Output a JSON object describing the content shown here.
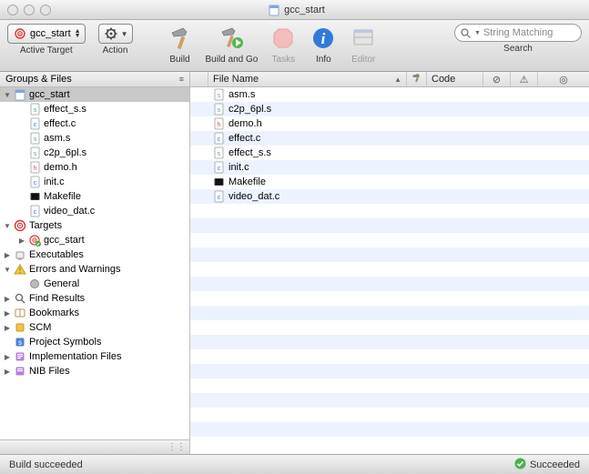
{
  "window": {
    "title": "gcc_start"
  },
  "toolbar": {
    "active_target": {
      "label": "gcc_start",
      "caption": "Active Target"
    },
    "action": {
      "caption": "Action"
    },
    "build": {
      "caption": "Build"
    },
    "build_go": {
      "caption": "Build and Go"
    },
    "tasks": {
      "caption": "Tasks"
    },
    "info": {
      "caption": "Info"
    },
    "editor": {
      "caption": "Editor"
    },
    "search": {
      "placeholder": "String Matching",
      "caption": "Search"
    }
  },
  "sidebar": {
    "header": "Groups & Files",
    "items": [
      {
        "label": "gcc_start",
        "icon": "xcode-project",
        "depth": 0,
        "disclosure": "open",
        "selected": true
      },
      {
        "label": "effect_s.s",
        "icon": "file-s",
        "depth": 1
      },
      {
        "label": "effect.c",
        "icon": "file-c",
        "depth": 1
      },
      {
        "label": "asm.s",
        "icon": "file-s",
        "depth": 1
      },
      {
        "label": "c2p_6pl.s",
        "icon": "file-s",
        "depth": 1
      },
      {
        "label": "demo.h",
        "icon": "file-h",
        "depth": 1
      },
      {
        "label": "init.c",
        "icon": "file-c",
        "depth": 1
      },
      {
        "label": "Makefile",
        "icon": "file-make",
        "depth": 1
      },
      {
        "label": "video_dat.c",
        "icon": "file-c",
        "depth": 1
      },
      {
        "label": "Targets",
        "icon": "target-group",
        "depth": 0,
        "disclosure": "open"
      },
      {
        "label": "gcc_start",
        "icon": "target",
        "depth": 1,
        "disclosure": "closed"
      },
      {
        "label": "Executables",
        "icon": "executables",
        "depth": 0,
        "disclosure": "closed"
      },
      {
        "label": "Errors and Warnings",
        "icon": "warnings",
        "depth": 0,
        "disclosure": "open"
      },
      {
        "label": "General",
        "icon": "general",
        "depth": 1
      },
      {
        "label": "Find Results",
        "icon": "find",
        "depth": 0,
        "disclosure": "closed"
      },
      {
        "label": "Bookmarks",
        "icon": "bookmarks",
        "depth": 0,
        "disclosure": "closed"
      },
      {
        "label": "SCM",
        "icon": "scm",
        "depth": 0,
        "disclosure": "closed"
      },
      {
        "label": "Project Symbols",
        "icon": "symbols",
        "depth": 0
      },
      {
        "label": "Implementation Files",
        "icon": "impl",
        "depth": 0,
        "disclosure": "closed"
      },
      {
        "label": "NIB Files",
        "icon": "nib",
        "depth": 0,
        "disclosure": "closed"
      }
    ]
  },
  "filelist": {
    "columns": {
      "check": "",
      "filename": "File Name",
      "sort": "▲",
      "build": "🔨",
      "code": "Code",
      "error": "⊘",
      "warn": "⚠",
      "target": "◎"
    },
    "rows": [
      {
        "name": "asm.s",
        "icon": "file-s"
      },
      {
        "name": "c2p_6pl.s",
        "icon": "file-s"
      },
      {
        "name": "demo.h",
        "icon": "file-h"
      },
      {
        "name": "effect.c",
        "icon": "file-c"
      },
      {
        "name": "effect_s.s",
        "icon": "file-s"
      },
      {
        "name": "init.c",
        "icon": "file-c"
      },
      {
        "name": "Makefile",
        "icon": "file-make"
      },
      {
        "name": "video_dat.c",
        "icon": "file-c"
      }
    ]
  },
  "statusbar": {
    "left": "Build succeeded",
    "right": "Succeeded"
  }
}
